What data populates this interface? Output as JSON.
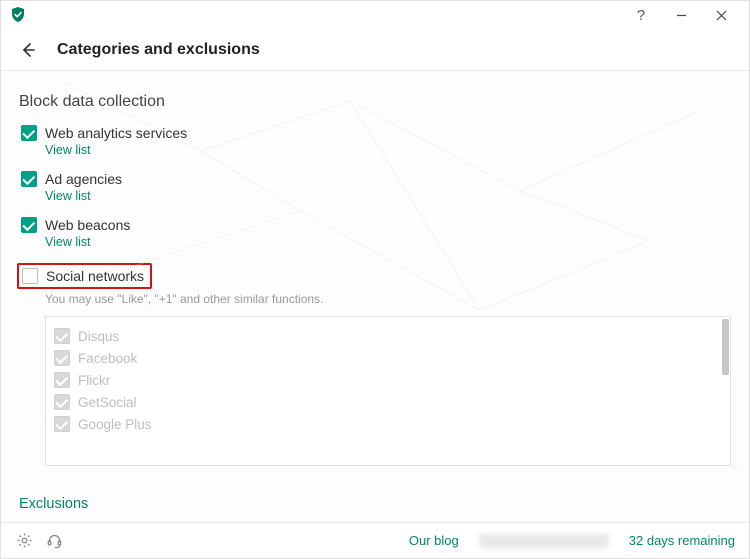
{
  "header": {
    "page_title": "Categories and exclusions"
  },
  "section": {
    "title": "Block data collection",
    "categories": [
      {
        "label": "Web analytics services",
        "checked": true,
        "view_list": "View list"
      },
      {
        "label": "Ad agencies",
        "checked": true,
        "view_list": "View list"
      },
      {
        "label": "Web beacons",
        "checked": true,
        "view_list": "View list"
      }
    ],
    "social": {
      "label": "Social networks",
      "checked": false,
      "hint": "You may use \"Like\", \"+1\" and other similar functions.",
      "items": [
        "Disqus",
        "Facebook",
        "Flickr",
        "GetSocial",
        "Google Plus"
      ]
    }
  },
  "exclusions_link": "Exclusions",
  "footer": {
    "blog": "Our blog",
    "license": "32 days remaining"
  }
}
